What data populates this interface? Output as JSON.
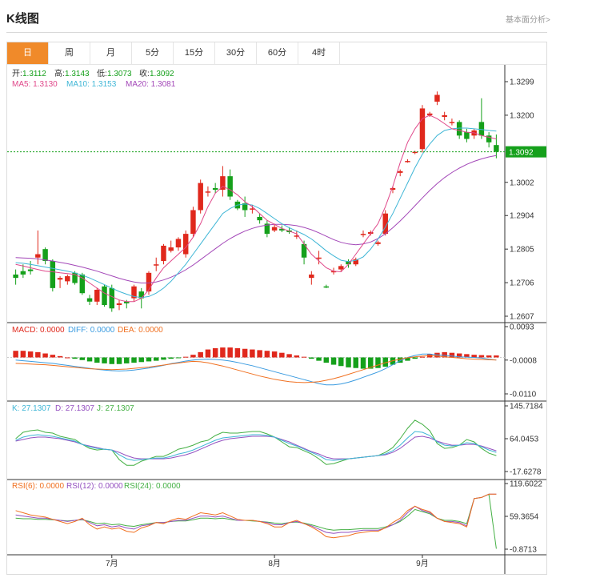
{
  "header": {
    "title": "K线图",
    "analysis_link": "基本面分析>"
  },
  "tabs": [
    {
      "label": "日",
      "active": true
    },
    {
      "label": "周",
      "active": false
    },
    {
      "label": "月",
      "active": false
    },
    {
      "label": "5分",
      "active": false
    },
    {
      "label": "15分",
      "active": false
    },
    {
      "label": "30分",
      "active": false
    },
    {
      "label": "60分",
      "active": false
    },
    {
      "label": "4时",
      "active": false
    }
  ],
  "colors": {
    "up": "#e0281c",
    "down": "#15a01b",
    "ma5": "#e0488a",
    "ma10": "#3fb6d6",
    "ma20": "#a347b8",
    "diff": "#3a9be0",
    "dea": "#f07020",
    "k": "#3fb6d6",
    "d": "#9450c0",
    "j": "#44b044",
    "rsi6": "#f07020",
    "rsi12": "#9450c0",
    "rsi24": "#44b044",
    "accent": "#f08a2a"
  },
  "chart_data": {
    "type": "candlestick",
    "info": {
      "open_label": "开:",
      "open": "1.3112",
      "high_label": "高:",
      "high": "1.3143",
      "low_label": "低:",
      "low": "1.3073",
      "close_label": "收:",
      "close": "1.3092"
    },
    "ma_labels": {
      "ma5": "MA5: 1.3130",
      "ma10": "MA10: 1.3153",
      "ma20": "MA20: 1.3081"
    },
    "price_ticks": [
      "1.3299",
      "1.3200",
      "1.3002",
      "1.2904",
      "1.2805",
      "1.2706",
      "1.2607"
    ],
    "price_ylim": [
      1.2607,
      1.3299
    ],
    "current_price": "1.3092",
    "x_labels": [
      {
        "label": "7月",
        "index": 13
      },
      {
        "label": "8月",
        "index": 35
      },
      {
        "label": "9月",
        "index": 55
      }
    ],
    "candles": [
      [
        1.273,
        1.2745,
        1.27,
        1.272
      ],
      [
        1.274,
        1.276,
        1.272,
        1.273
      ],
      [
        1.2745,
        1.277,
        1.273,
        1.274
      ],
      [
        1.278,
        1.286,
        1.276,
        1.279
      ],
      [
        1.2805,
        1.281,
        1.276,
        1.277
      ],
      [
        1.277,
        1.2775,
        1.268,
        1.269
      ],
      [
        1.2715,
        1.2725,
        1.269,
        1.272
      ],
      [
        1.271,
        1.273,
        1.27,
        1.2725
      ],
      [
        1.2735,
        1.274,
        1.27,
        1.2705
      ],
      [
        1.273,
        1.2735,
        1.267,
        1.2675
      ],
      [
        1.266,
        1.267,
        1.264,
        1.265
      ],
      [
        1.265,
        1.269,
        1.264,
        1.2685
      ],
      [
        1.2695,
        1.27,
        1.2635,
        1.264
      ],
      [
        1.269,
        1.27,
        1.262,
        1.263
      ],
      [
        1.264,
        1.2655,
        1.2625,
        1.2645
      ],
      [
        1.265,
        1.2655,
        1.263,
        1.2645
      ],
      [
        1.266,
        1.27,
        1.265,
        1.2695
      ],
      [
        1.268,
        1.269,
        1.263,
        1.266
      ],
      [
        1.268,
        1.274,
        1.267,
        1.2735
      ],
      [
        1.276,
        1.278,
        1.274,
        1.276
      ],
      [
        1.277,
        1.282,
        1.276,
        1.2815
      ],
      [
        1.28,
        1.283,
        1.2795,
        1.281
      ],
      [
        1.281,
        1.284,
        1.28,
        1.2835
      ],
      [
        1.279,
        1.286,
        1.278,
        1.285
      ],
      [
        1.285,
        1.293,
        1.284,
        1.292
      ],
      [
        1.292,
        1.301,
        1.291,
        1.3
      ],
      [
        1.2975,
        1.299,
        1.296,
        1.2975
      ],
      [
        1.2985,
        1.3,
        1.297,
        1.298
      ],
      [
        1.298,
        1.305,
        1.296,
        1.302
      ],
      [
        1.302,
        1.304,
        1.295,
        1.296
      ],
      [
        1.2945,
        1.295,
        1.292,
        1.2925
      ],
      [
        1.294,
        1.296,
        1.29,
        1.292
      ],
      [
        1.2925,
        1.2935,
        1.291,
        1.2925
      ],
      [
        1.29,
        1.291,
        1.288,
        1.289
      ],
      [
        1.288,
        1.289,
        1.284,
        1.285
      ],
      [
        1.286,
        1.288,
        1.2855,
        1.287
      ],
      [
        1.2865,
        1.2875,
        1.2855,
        1.286
      ],
      [
        1.286,
        1.287,
        1.285,
        1.2855
      ],
      [
        1.2845,
        1.286,
        1.2835,
        1.2845
      ],
      [
        1.282,
        1.283,
        1.276,
        1.278
      ],
      [
        1.272,
        1.274,
        1.27,
        1.273
      ],
      [
        1.278,
        1.28,
        1.276,
        1.278
      ],
      [
        1.2695,
        1.27,
        1.269,
        1.2693
      ],
      [
        1.274,
        1.275,
        1.273,
        1.274
      ],
      [
        1.2745,
        1.276,
        1.274,
        1.2755
      ],
      [
        1.277,
        1.2775,
        1.275,
        1.276
      ],
      [
        1.276,
        1.278,
        1.2755,
        1.2775
      ],
      [
        1.285,
        1.286,
        1.284,
        1.285
      ],
      [
        1.285,
        1.286,
        1.2845,
        1.2855
      ],
      [
        1.282,
        1.283,
        1.2815,
        1.2825
      ],
      [
        1.285,
        1.292,
        1.2845,
        1.291
      ],
      [
        1.298,
        1.299,
        1.297,
        1.2985
      ],
      [
        1.303,
        1.304,
        1.302,
        1.3035
      ],
      [
        1.3065,
        1.307,
        1.306,
        1.3065
      ],
      [
        1.309,
        1.3095,
        1.3085,
        1.3092
      ],
      [
        1.31,
        1.323,
        1.309,
        1.322
      ],
      [
        1.32,
        1.321,
        1.3195,
        1.3205
      ],
      [
        1.324,
        1.327,
        1.323,
        1.326
      ],
      [
        1.3195,
        1.321,
        1.3185,
        1.32
      ],
      [
        1.318,
        1.319,
        1.317,
        1.318
      ],
      [
        1.318,
        1.3185,
        1.313,
        1.314
      ],
      [
        1.315,
        1.316,
        1.312,
        1.313
      ],
      [
        1.314,
        1.316,
        1.313,
        1.3155
      ],
      [
        1.318,
        1.325,
        1.313,
        1.314
      ],
      [
        1.314,
        1.315,
        1.3105,
        1.312
      ],
      [
        1.3112,
        1.3143,
        1.3073,
        1.3092
      ]
    ],
    "ma5": [
      1.276,
      1.2755,
      1.275,
      1.2745,
      1.274,
      1.2738,
      1.2735,
      1.2733,
      1.273,
      1.272,
      1.2705,
      1.269,
      1.2675,
      1.2665,
      1.2655,
      1.265,
      1.265,
      1.266,
      1.2685,
      1.272,
      1.275,
      1.277,
      1.279,
      1.281,
      1.284,
      1.288,
      1.293,
      1.297,
      1.299,
      1.298,
      1.2965,
      1.2945,
      1.293,
      1.291,
      1.289,
      1.2878,
      1.2866,
      1.2858,
      1.285,
      1.282,
      1.279,
      1.277,
      1.275,
      1.274,
      1.2738,
      1.276,
      1.279,
      1.282,
      1.285,
      1.288,
      1.293,
      1.299,
      1.306,
      1.312,
      1.316,
      1.319,
      1.32,
      1.319,
      1.3175,
      1.316,
      1.3155,
      1.315,
      1.3148,
      1.314,
      1.3135,
      1.313
    ],
    "ma10": [
      1.2765,
      1.2763,
      1.276,
      1.2756,
      1.2752,
      1.2748,
      1.2744,
      1.274,
      1.2735,
      1.2728,
      1.272,
      1.271,
      1.27,
      1.269,
      1.268,
      1.2672,
      1.2665,
      1.2662,
      1.2665,
      1.2675,
      1.269,
      1.271,
      1.2735,
      1.276,
      1.279,
      1.282,
      1.285,
      1.288,
      1.291,
      1.2925,
      1.2935,
      1.2938,
      1.2935,
      1.2925,
      1.291,
      1.2895,
      1.288,
      1.2868,
      1.2858,
      1.2848,
      1.2835,
      1.2818,
      1.28,
      1.2785,
      1.2772,
      1.2768,
      1.2772,
      1.2782,
      1.2805,
      1.2835,
      1.287,
      1.291,
      1.2955,
      1.3,
      1.3045,
      1.3085,
      1.3115,
      1.314,
      1.3155,
      1.316,
      1.3162,
      1.3162,
      1.316,
      1.3158,
      1.3155,
      1.3153
    ],
    "ma20": [
      1.278,
      1.2779,
      1.2778,
      1.2776,
      1.2773,
      1.277,
      1.2766,
      1.2762,
      1.2757,
      1.2752,
      1.2746,
      1.274,
      1.2733,
      1.2726,
      1.2719,
      1.2713,
      1.2708,
      1.2705,
      1.2705,
      1.2708,
      1.2714,
      1.2722,
      1.2732,
      1.2744,
      1.2758,
      1.2774,
      1.279,
      1.2806,
      1.2822,
      1.2836,
      1.2848,
      1.2858,
      1.2866,
      1.2872,
      1.2876,
      1.2878,
      1.2878,
      1.2877,
      1.2874,
      1.2869,
      1.2862,
      1.2853,
      1.2843,
      1.2833,
      1.2825,
      1.282,
      1.2818,
      1.282,
      1.2826,
      1.2836,
      1.285,
      1.2868,
      1.2888,
      1.291,
      1.2933,
      1.2956,
      1.2978,
      1.2998,
      1.3016,
      1.3031,
      1.3044,
      1.3055,
      1.3064,
      1.3071,
      1.3077,
      1.3081
    ],
    "macd": {
      "label": "MACD: 0.0000",
      "diff_label": "DIFF: 0.0000",
      "dea_label": "DEA: 0.0000",
      "ticks": [
        "0.0093",
        "-0.0008",
        "-0.0110"
      ],
      "ylim": [
        -0.011,
        0.0093
      ],
      "hist": [
        0.002,
        0.002,
        0.0018,
        0.0016,
        0.0012,
        0.0008,
        0.0004,
        0.0,
        -0.0004,
        -0.0008,
        -0.0012,
        -0.0016,
        -0.0018,
        -0.002,
        -0.002,
        -0.0018,
        -0.0016,
        -0.0014,
        -0.0012,
        -0.001,
        -0.0007,
        -0.0004,
        -0.0001,
        0.0002,
        0.0008,
        0.0016,
        0.0024,
        0.0028,
        0.003,
        0.003,
        0.0028,
        0.0026,
        0.0024,
        0.0022,
        0.002,
        0.0018,
        0.0014,
        0.001,
        0.0006,
        0.0002,
        -0.0004,
        -0.001,
        -0.0016,
        -0.0022,
        -0.0026,
        -0.003,
        -0.0032,
        -0.0034,
        -0.0034,
        -0.0032,
        -0.0028,
        -0.0022,
        -0.0016,
        -0.001,
        -0.0004,
        0.0002,
        0.001,
        0.0014,
        0.0016,
        0.0014,
        0.0012,
        0.001,
        0.0008,
        0.0007,
        0.0006,
        0.0006
      ],
      "diff": [
        -0.0008,
        -0.001,
        -0.0012,
        -0.0014,
        -0.0016,
        -0.0018,
        -0.0021,
        -0.0024,
        -0.0027,
        -0.003,
        -0.0033,
        -0.0036,
        -0.0038,
        -0.004,
        -0.0041,
        -0.004,
        -0.0038,
        -0.0035,
        -0.0032,
        -0.0028,
        -0.0024,
        -0.0019,
        -0.0015,
        -0.0011,
        -0.0008,
        -0.0006,
        -0.0005,
        -0.0006,
        -0.0008,
        -0.0011,
        -0.0015,
        -0.002,
        -0.0025,
        -0.0031,
        -0.0037,
        -0.0043,
        -0.0049,
        -0.0055,
        -0.0061,
        -0.0067,
        -0.0073,
        -0.0079,
        -0.0083,
        -0.0083,
        -0.008,
        -0.0075,
        -0.0068,
        -0.006,
        -0.0052,
        -0.0044,
        -0.0034,
        -0.0022,
        -0.001,
        0.0,
        0.0006,
        0.001,
        0.001,
        0.0008,
        0.0006,
        0.0004,
        0.0002,
        0.0001,
        0.0,
        -0.0002,
        -0.0005,
        -0.0008
      ],
      "dea": [
        -0.0018,
        -0.0019,
        -0.002,
        -0.0021,
        -0.0022,
        -0.0024,
        -0.0026,
        -0.0028,
        -0.003,
        -0.0032,
        -0.0034,
        -0.0035,
        -0.0036,
        -0.0037,
        -0.0036,
        -0.0035,
        -0.0033,
        -0.0031,
        -0.0029,
        -0.0026,
        -0.0023,
        -0.002,
        -0.0017,
        -0.0014,
        -0.0012,
        -0.0013,
        -0.0016,
        -0.0021,
        -0.0026,
        -0.0032,
        -0.0038,
        -0.0044,
        -0.005,
        -0.0056,
        -0.0061,
        -0.0066,
        -0.007,
        -0.0073,
        -0.0075,
        -0.0076,
        -0.0075,
        -0.0073,
        -0.0069,
        -0.0064,
        -0.0058,
        -0.0051,
        -0.0044,
        -0.0037,
        -0.003,
        -0.0023,
        -0.0016,
        -0.001,
        -0.0005,
        -0.0001,
        0.0002,
        0.0004,
        0.0005,
        0.0004,
        0.0002,
        0.0,
        -0.0002,
        -0.0004,
        -0.0005,
        -0.0006,
        -0.0007,
        -0.0008
      ]
    },
    "kdj": {
      "k_label": "K: 27.1307",
      "d_label": "D: 27.1307",
      "j_label": "J: 27.1307",
      "ticks": [
        "145.7184",
        "64.0453",
        "-17.6278"
      ],
      "ylim": [
        -17.6278,
        145.7184
      ],
      "k": [
        60,
        68,
        72,
        74,
        72,
        70,
        66,
        62,
        58,
        50,
        44,
        40,
        38,
        36,
        24,
        14,
        10,
        12,
        14,
        16,
        16,
        20,
        26,
        30,
        36,
        44,
        52,
        60,
        66,
        68,
        70,
        72,
        74,
        74,
        72,
        68,
        60,
        52,
        46,
        38,
        30,
        22,
        12,
        10,
        12,
        14,
        16,
        18,
        20,
        22,
        26,
        34,
        48,
        66,
        82,
        80,
        72,
        56,
        48,
        46,
        48,
        54,
        52,
        44,
        36,
        30
      ],
      "d": [
        58,
        62,
        66,
        68,
        68,
        66,
        64,
        60,
        56,
        50,
        46,
        42,
        38,
        36,
        30,
        22,
        16,
        14,
        14,
        14,
        14,
        16,
        20,
        24,
        30,
        38,
        46,
        54,
        60,
        64,
        66,
        68,
        70,
        70,
        70,
        68,
        62,
        56,
        48,
        40,
        32,
        26,
        18,
        14,
        14,
        14,
        16,
        18,
        20,
        22,
        24,
        30,
        40,
        54,
        68,
        70,
        66,
        58,
        52,
        48,
        48,
        50,
        50,
        46,
        40,
        34
      ],
      "j": [
        64,
        80,
        84,
        86,
        80,
        78,
        70,
        66,
        62,
        50,
        40,
        36,
        38,
        36,
        12,
        -2,
        -2,
        8,
        14,
        20,
        20,
        28,
        38,
        42,
        48,
        56,
        60,
        72,
        80,
        78,
        78,
        80,
        82,
        82,
        76,
        68,
        56,
        44,
        42,
        34,
        26,
        14,
        0,
        2,
        8,
        14,
        16,
        18,
        20,
        22,
        30,
        42,
        64,
        90,
        110,
        100,
        84,
        52,
        40,
        42,
        48,
        62,
        56,
        40,
        28,
        22
      ]
    },
    "rsi": {
      "rsi6_label": "RSI(6): 0.0000",
      "rsi12_label": "RSI(12): 0.0000",
      "rsi24_label": "RSI(24): 0.0000",
      "ticks": [
        "119.6022",
        "59.3654",
        "-0.8713"
      ],
      "ylim": [
        -0.8713,
        119.6022
      ],
      "rsi6": [
        70,
        66,
        62,
        60,
        58,
        54,
        50,
        46,
        50,
        56,
        44,
        36,
        40,
        36,
        38,
        32,
        30,
        38,
        42,
        48,
        46,
        52,
        56,
        54,
        60,
        66,
        64,
        62,
        66,
        60,
        54,
        52,
        52,
        50,
        46,
        40,
        40,
        48,
        52,
        46,
        40,
        32,
        22,
        20,
        22,
        24,
        28,
        30,
        32,
        32,
        38,
        48,
        56,
        70,
        78,
        72,
        68,
        56,
        50,
        48,
        46,
        40,
        92,
        94,
        100,
        100
      ],
      "rsi12": [
        62,
        60,
        58,
        56,
        56,
        54,
        52,
        50,
        52,
        54,
        48,
        42,
        44,
        40,
        42,
        38,
        36,
        42,
        44,
        48,
        48,
        50,
        52,
        52,
        56,
        60,
        60,
        58,
        60,
        56,
        52,
        52,
        52,
        50,
        48,
        44,
        44,
        48,
        50,
        46,
        42,
        36,
        30,
        28,
        30,
        30,
        32,
        34,
        34,
        34,
        38,
        44,
        52,
        66,
        78,
        70,
        66,
        56,
        50,
        50,
        48,
        42,
        92,
        94,
        100,
        100
      ],
      "rsi24": [
        56,
        55,
        55,
        54,
        54,
        53,
        52,
        51,
        52,
        53,
        50,
        46,
        47,
        44,
        45,
        42,
        41,
        44,
        46,
        48,
        48,
        50,
        51,
        51,
        53,
        56,
        56,
        55,
        56,
        54,
        52,
        52,
        51,
        50,
        49,
        47,
        46,
        48,
        49,
        47,
        44,
        40,
        36,
        34,
        35,
        35,
        36,
        37,
        37,
        37,
        40,
        44,
        50,
        60,
        72,
        68,
        64,
        56,
        52,
        52,
        50,
        46,
        92,
        94,
        100,
        0
      ]
    }
  }
}
